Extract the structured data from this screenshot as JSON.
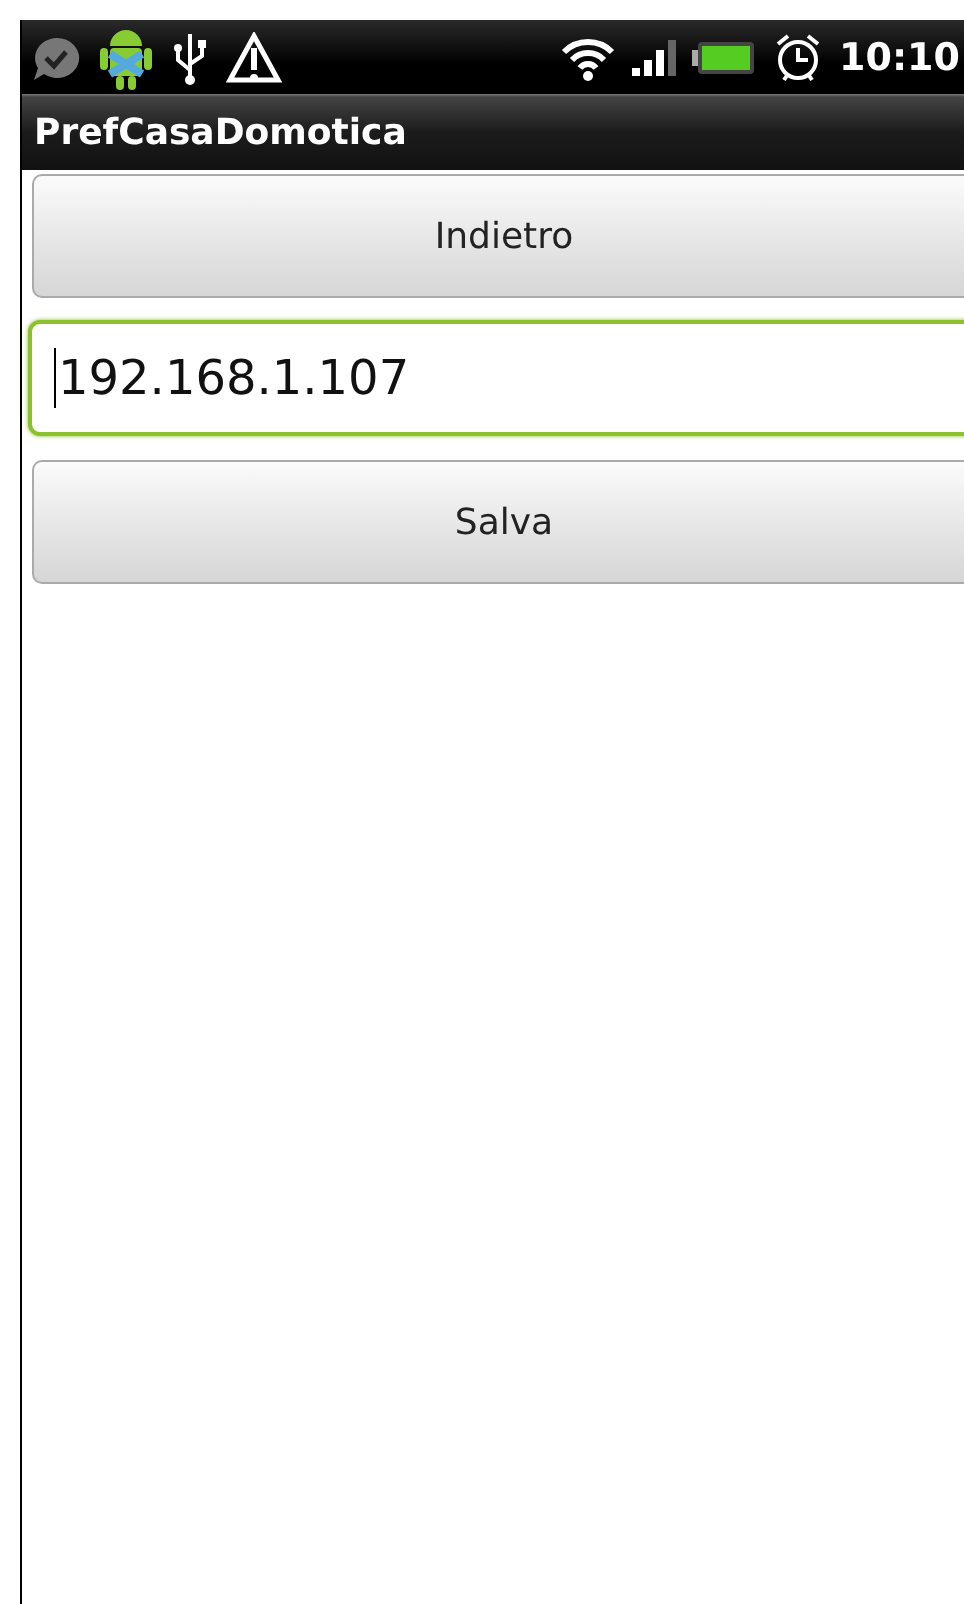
{
  "status_bar": {
    "time": "10:10"
  },
  "title_bar": {
    "title": "PrefCasaDomotica"
  },
  "back_button": {
    "label": "Indietro"
  },
  "address_field": {
    "value": "192.168.1.107",
    "focused": true
  },
  "save_button": {
    "label": "Salva"
  }
}
